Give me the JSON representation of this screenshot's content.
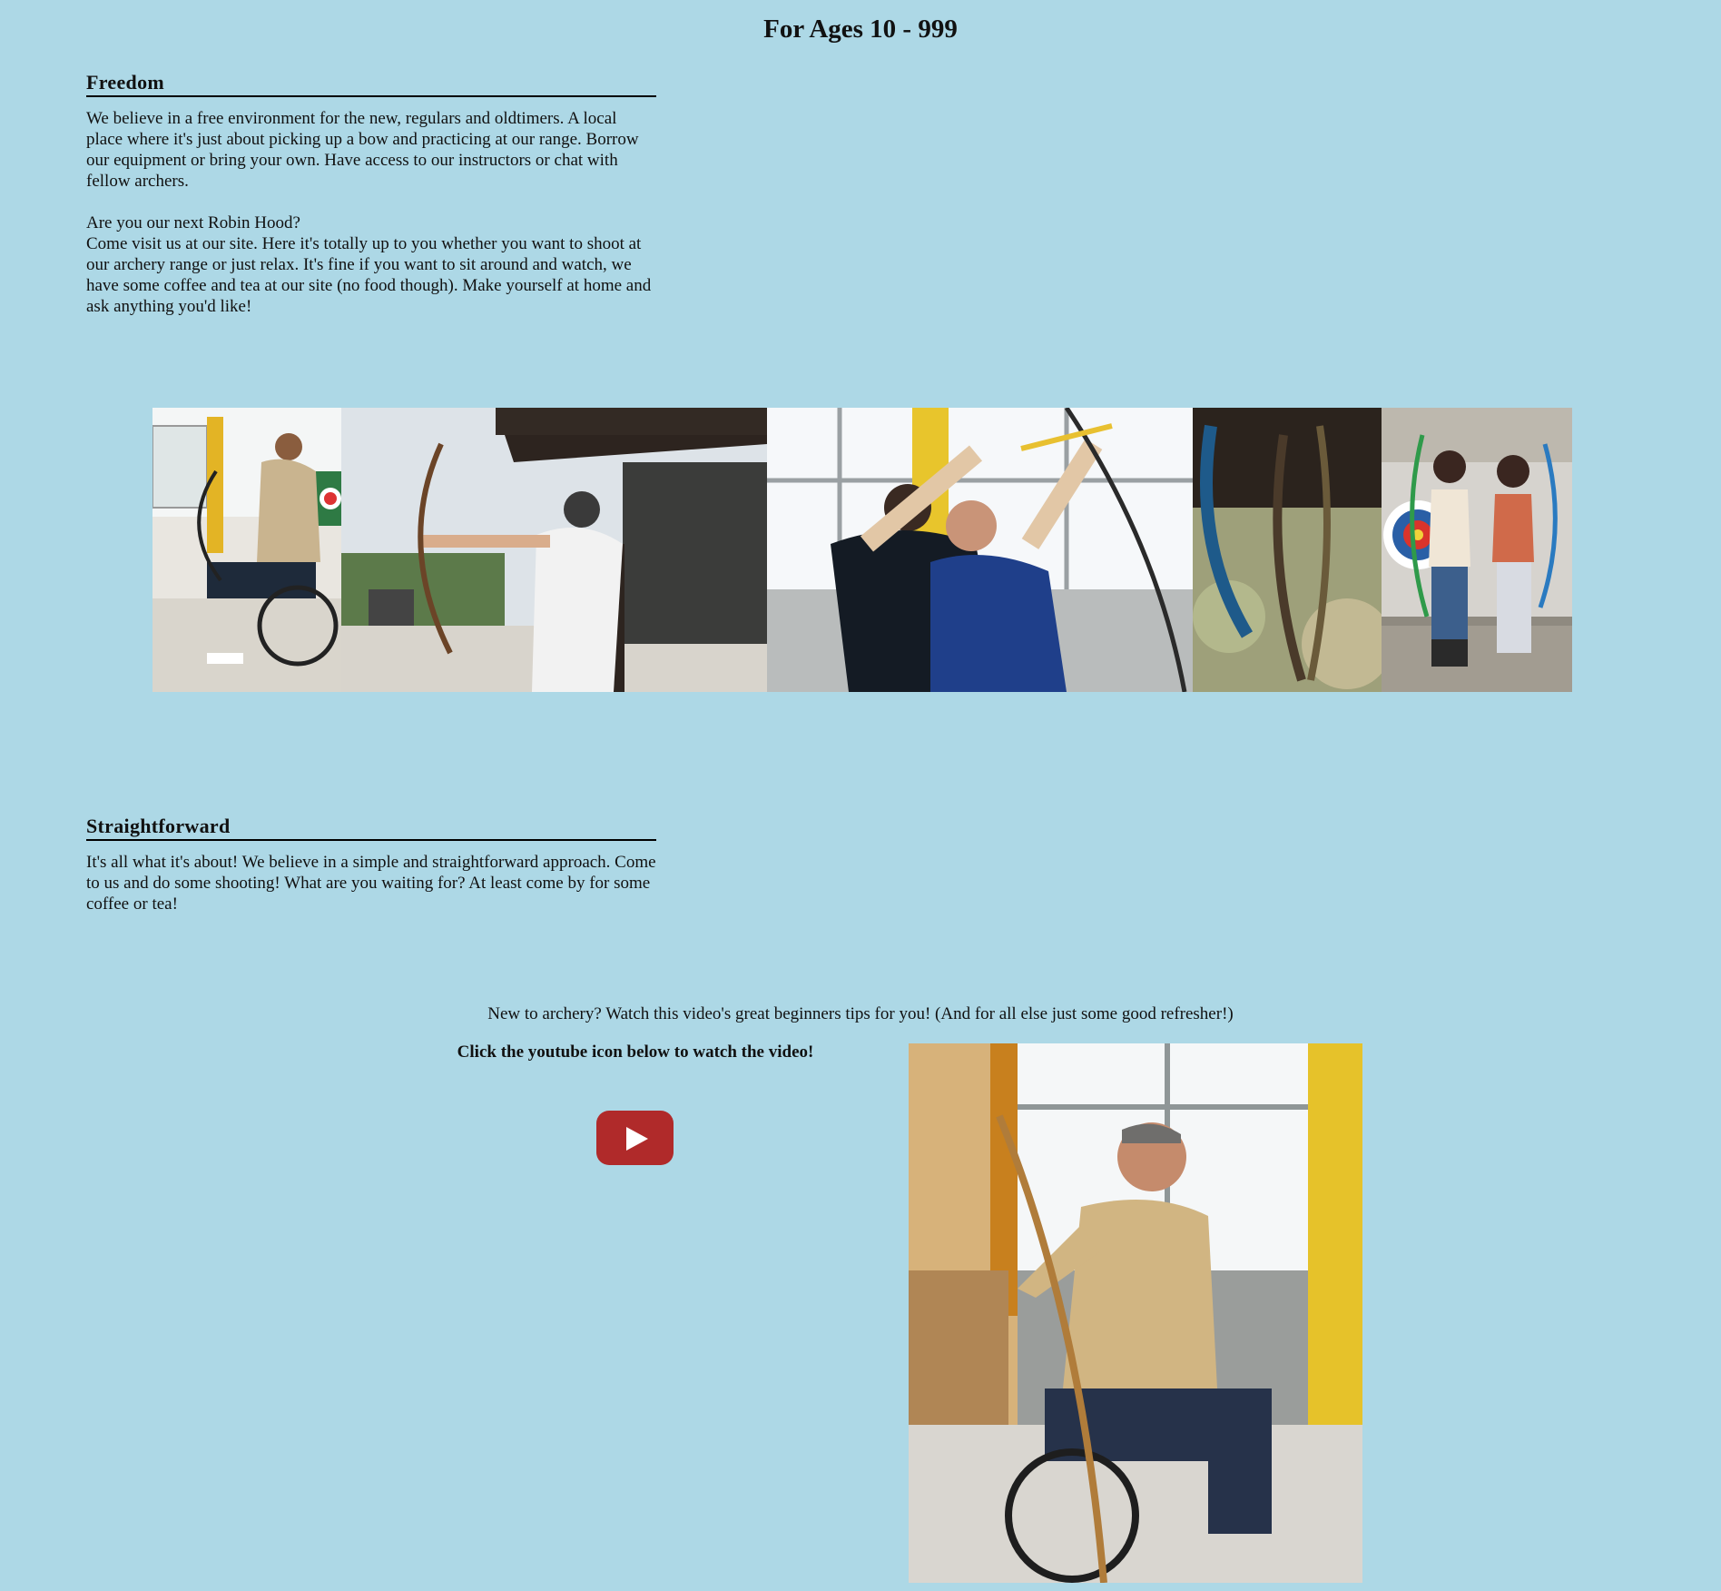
{
  "page": {
    "title": "For Ages 10 - 999",
    "background_color": "#add8e6"
  },
  "freedom": {
    "heading": "Freedom",
    "paragraph_1": "We believe in a free environment for the new, regulars and oldtimers. A local place where it's just about picking up a bow and practicing at our range. Borrow our equipment or bring your own. Have access to our instructors or chat with fellow archers.",
    "question": "Are you our next Robin Hood?",
    "paragraph_2": "Come visit us at our site. Here it's totally up to you whether you want to shoot at our archery range or just relax. It's fine if you want to sit around and watch, we have some coffee and tea at our site (no food though). Make yourself at home and ask anything you'd like!"
  },
  "gallery": {
    "photos": [
      {
        "subject": "archer in wheelchair with compound bow"
      },
      {
        "subject": "archer drawing bow at outdoor range"
      },
      {
        "subject": "instructor helping archer aim"
      },
      {
        "subject": "bows hanging on rack"
      },
      {
        "subject": "two girls holding bows in front of target"
      }
    ]
  },
  "straightforward": {
    "heading": "Straightforward",
    "paragraph": "It's all what it's about! We believe in a simple and straightforward approach. Come to us and do some shooting! What are you waiting for? At least come by for some coffee or tea!"
  },
  "video": {
    "intro": "New to archery? Watch this video's great beginners tips for you! (And for all else just some good refresher!)",
    "cta": "Click the youtube icon below to watch the video!",
    "button_icon": "youtube-play-icon",
    "button_color": "#b02a2a"
  },
  "feature_photo": {
    "subject": "smiling archer in wheelchair holding recurve bow"
  }
}
